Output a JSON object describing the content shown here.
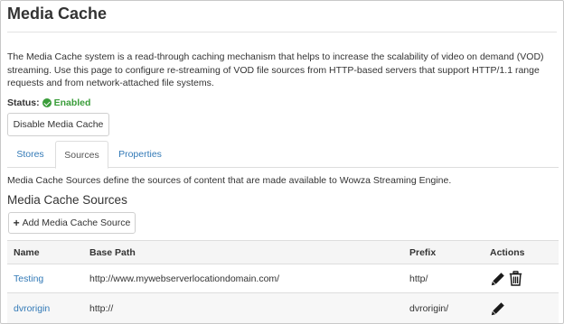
{
  "page": {
    "title": "Media Cache",
    "intro": "The Media Cache system is a read-through caching mechanism that helps to increase the scalability of video on demand (VOD) streaming. Use this page to configure re-streaming of VOD file sources from HTTP-based servers that support HTTP/1.1 range requests and from network-attached file systems."
  },
  "status": {
    "label": "Status:",
    "value": "Enabled",
    "icon": "check-circle-icon",
    "color": "#3a9d3a"
  },
  "disable_button": {
    "label": "Disable Media Cache"
  },
  "tabs": [
    {
      "label": "Stores",
      "active": false
    },
    {
      "label": "Sources",
      "active": true
    },
    {
      "label": "Properties",
      "active": false
    }
  ],
  "sources": {
    "description": "Media Cache Sources define the sources of content that are made available to Wowza Streaming Engine.",
    "title": "Media Cache Sources",
    "add_button": {
      "icon": "plus-icon",
      "label": "Add Media Cache Source"
    },
    "table": {
      "columns": [
        "Name",
        "Base Path",
        "Prefix",
        "Actions"
      ],
      "rows": [
        {
          "name": "Testing",
          "base_path": "http://www.mywebserverlocationdomain.com/",
          "prefix": "http/",
          "actions": [
            "edit-icon",
            "delete-icon"
          ]
        },
        {
          "name": "dvrorigin",
          "base_path": "http://",
          "prefix": "dvrorigin/",
          "actions": [
            "edit-icon"
          ]
        }
      ]
    }
  },
  "colors": {
    "link": "#337ab7",
    "text": "#333333",
    "header_bg": "#f5f5f5",
    "border": "#dddddd"
  }
}
